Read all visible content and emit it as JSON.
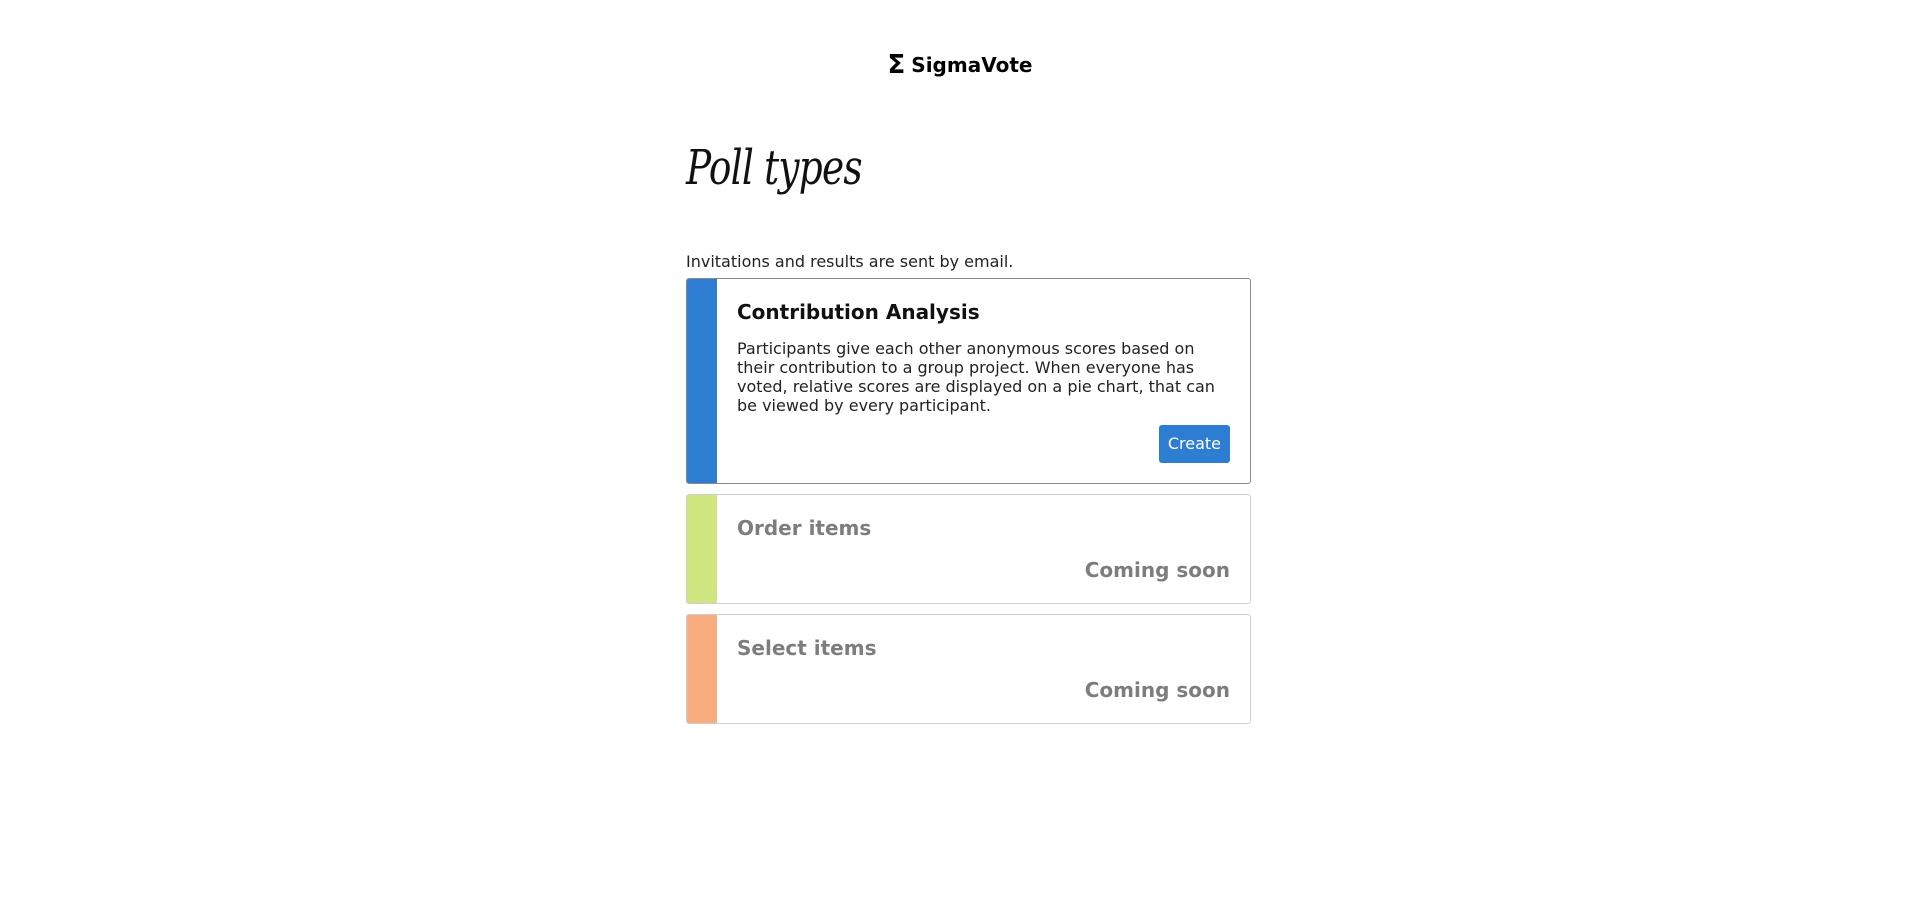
{
  "brand": {
    "icon": "sigma-icon",
    "symbol": "Σ",
    "name": "SigmaVote"
  },
  "page": {
    "title": "Poll types",
    "intro": "Invitations and results are sent by email."
  },
  "poll_types": [
    {
      "title": "Contribution Analysis",
      "description": "Participants give each other anonymous scores based on their contribution to a group project. When everyone has voted, relative scores are displayed on a pie chart, that can be viewed by every participant.",
      "action_label": "Create",
      "color": "#2d7dd2"
    },
    {
      "title": "Order items",
      "status": "Coming soon",
      "color": "#cfe57f"
    },
    {
      "title": "Select items",
      "status": "Coming soon",
      "color": "#f9ad7e"
    }
  ],
  "colors": {
    "primary": "#2d7dd2",
    "muted_text": "#7d7d7d",
    "card_border": "#cfcfcf"
  }
}
